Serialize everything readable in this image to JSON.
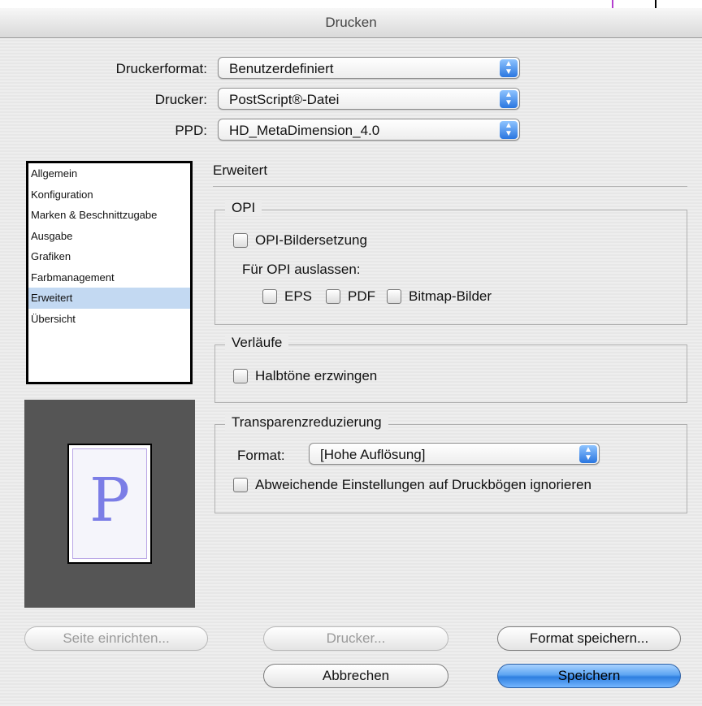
{
  "window": {
    "title": "Drucken"
  },
  "printer_settings": {
    "rows": [
      {
        "label": "Druckerformat:",
        "value": "Benutzerdefiniert"
      },
      {
        "label": "Drucker:",
        "value": "PostScript®-Datei"
      },
      {
        "label": "PPD:",
        "value": "HD_MetaDimension_4.0"
      }
    ]
  },
  "sidebar": {
    "items": [
      {
        "label": "Allgemein",
        "selected": false
      },
      {
        "label": "Konfiguration",
        "selected": false
      },
      {
        "label": "Marken & Beschnittzugabe",
        "selected": false
      },
      {
        "label": "Ausgabe",
        "selected": false
      },
      {
        "label": "Grafiken",
        "selected": false
      },
      {
        "label": "Farbmanagement",
        "selected": false
      },
      {
        "label": "Erweitert",
        "selected": true
      },
      {
        "label": "Übersicht",
        "selected": false
      }
    ]
  },
  "preview": {
    "letter": "P",
    "letter_color": "#7b7de6",
    "background": "#555555"
  },
  "main": {
    "title": "Erweitert",
    "opi": {
      "title": "OPI",
      "replace_label": "OPI-Bildersetzung",
      "omit_label": "Für OPI auslassen:",
      "eps_label": "EPS",
      "pdf_label": "PDF",
      "bitmap_label": "Bitmap-Bilder"
    },
    "gradients": {
      "title": "Verläufe",
      "force_halftones_label": "Halbtöne erzwingen"
    },
    "transparency": {
      "title": "Transparenzreduzierung",
      "format_label": "Format:",
      "format_value": "[Hohe Auflösung]",
      "ignore_label": "Abweichende Einstellungen auf Druckbögen ignorieren"
    }
  },
  "buttons": {
    "page_setup": "Seite einrichten...",
    "printer": "Drucker...",
    "save_preset": "Format speichern...",
    "cancel": "Abbrechen",
    "save": "Speichern"
  },
  "colors": {
    "accent": "#2e7fe0",
    "selection": "#c3d9f2"
  }
}
